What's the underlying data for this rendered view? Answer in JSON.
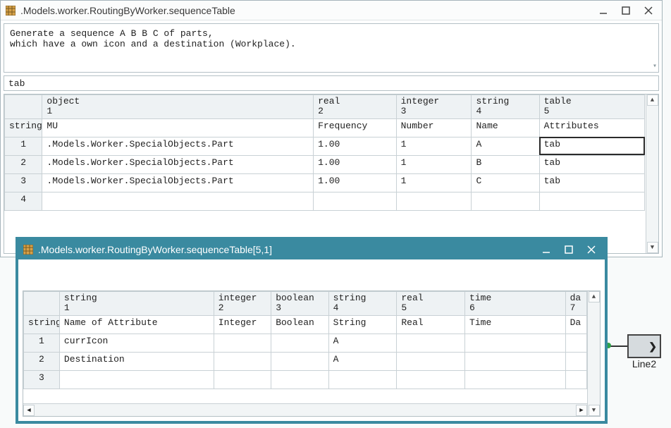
{
  "main_window": {
    "title": ".Models.worker.RoutingByWorker.sequenceTable",
    "description": "Generate a sequence A B B C of parts,\nwhich have a own icon and a destination (Workplace).",
    "input_value": "tab",
    "columns": [
      {
        "type": "object",
        "index": "1",
        "label": "MU"
      },
      {
        "type": "real",
        "index": "2",
        "label": "Frequency"
      },
      {
        "type": "integer",
        "index": "3",
        "label": "Number"
      },
      {
        "type": "string",
        "index": "4",
        "label": "Name"
      },
      {
        "type": "table",
        "index": "5",
        "label": "Attributes"
      }
    ],
    "row_header_label": "string",
    "rows": [
      {
        "n": "1",
        "c": [
          ".Models.Worker.SpecialObjects.Part",
          "1.00",
          "1",
          "A",
          "tab"
        ]
      },
      {
        "n": "2",
        "c": [
          ".Models.Worker.SpecialObjects.Part",
          "1.00",
          "1",
          "B",
          "tab"
        ]
      },
      {
        "n": "3",
        "c": [
          ".Models.Worker.SpecialObjects.Part",
          "1.00",
          "1",
          "C",
          "tab"
        ]
      },
      {
        "n": "4",
        "c": [
          "",
          "",
          "",
          "",
          ""
        ]
      }
    ],
    "selected_cell": {
      "row": 0,
      "col": 4
    }
  },
  "sub_window": {
    "title": ".Models.worker.RoutingByWorker.sequenceTable[5,1]",
    "columns": [
      {
        "type": "string",
        "index": "1",
        "label": "Name of Attribute"
      },
      {
        "type": "integer",
        "index": "2",
        "label": "Integer"
      },
      {
        "type": "boolean",
        "index": "3",
        "label": "Boolean"
      },
      {
        "type": "string",
        "index": "4",
        "label": "String"
      },
      {
        "type": "real",
        "index": "5",
        "label": "Real"
      },
      {
        "type": "time",
        "index": "6",
        "label": "Time"
      },
      {
        "type": "date",
        "index": "7",
        "label": "Date"
      }
    ],
    "row_header_label": "string",
    "rows": [
      {
        "n": "1",
        "c": [
          "currIcon",
          "",
          "",
          "A",
          "",
          "",
          ""
        ]
      },
      {
        "n": "2",
        "c": [
          "Destination",
          "",
          "",
          "A",
          "",
          "",
          ""
        ]
      },
      {
        "n": "3",
        "c": [
          "",
          "",
          "",
          "",
          "",
          "",
          ""
        ]
      }
    ]
  },
  "background": {
    "node_label": "Line2"
  }
}
